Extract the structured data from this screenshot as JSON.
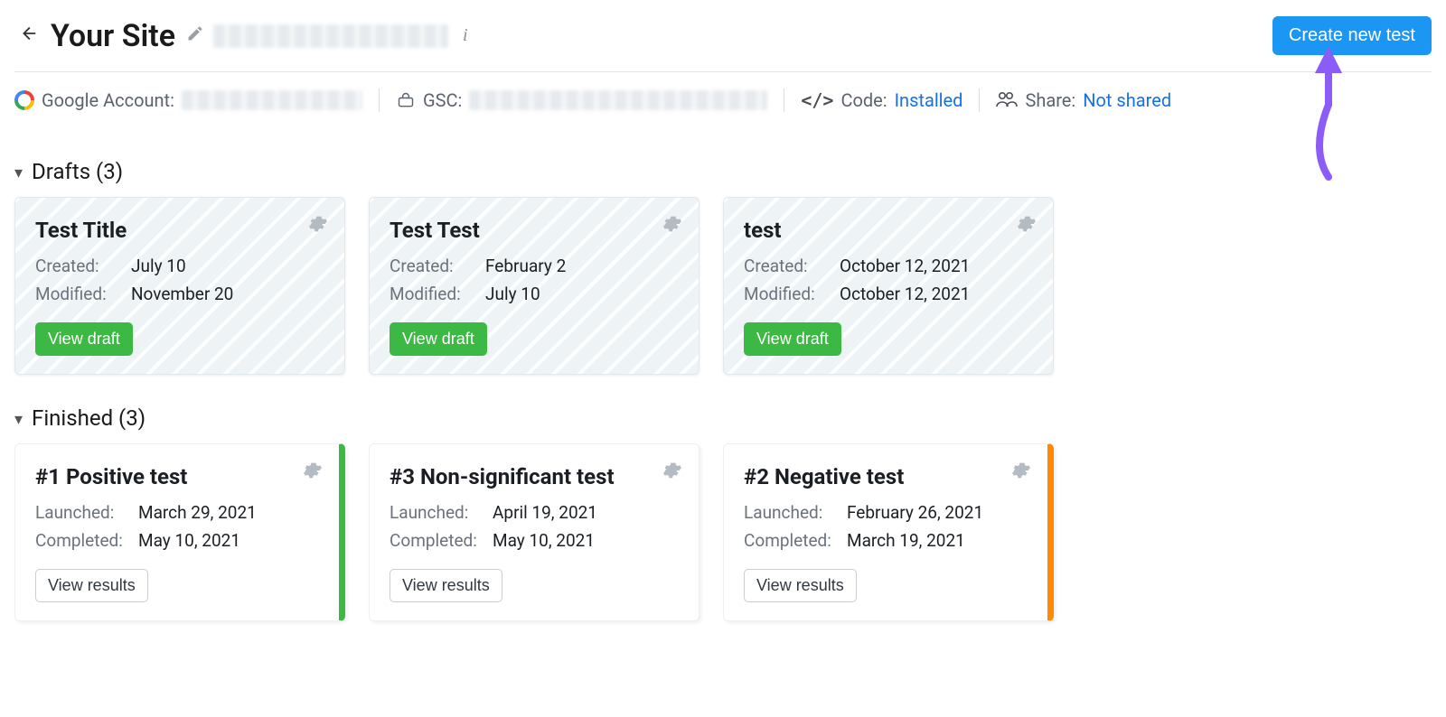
{
  "header": {
    "title": "Your Site",
    "create_button": "Create new test"
  },
  "info_bar": {
    "google_label": "Google Account:",
    "gsc_label": "GSC:",
    "code_label": "Code:",
    "code_value": "Installed",
    "share_label": "Share:",
    "share_value": "Not shared"
  },
  "sections": {
    "drafts": {
      "heading": "Drafts (3)",
      "cards": [
        {
          "title": "Test Title",
          "created_label": "Created:",
          "created": "July 10",
          "modified_label": "Modified:",
          "modified": "November 20",
          "button": "View draft"
        },
        {
          "title": "Test Test",
          "created_label": "Created:",
          "created": "February 2",
          "modified_label": "Modified:",
          "modified": "July 10",
          "button": "View draft"
        },
        {
          "title": "test",
          "created_label": "Created:",
          "created": "October 12, 2021",
          "modified_label": "Modified:",
          "modified": "October 12, 2021",
          "button": "View draft"
        }
      ]
    },
    "finished": {
      "heading": "Finished (3)",
      "cards": [
        {
          "title": "#1 Positive test",
          "accent": "green",
          "launched_label": "Launched:",
          "launched": "March 29, 2021",
          "completed_label": "Completed:",
          "completed": "May 10, 2021",
          "button": "View results"
        },
        {
          "title": "#3 Non-significant test",
          "accent": "",
          "launched_label": "Launched:",
          "launched": "April 19, 2021",
          "completed_label": "Completed:",
          "completed": "May 10, 2021",
          "button": "View results"
        },
        {
          "title": "#2 Negative test",
          "accent": "orange",
          "launched_label": "Launched:",
          "launched": "February 26, 2021",
          "completed_label": "Completed:",
          "completed": "March 19, 2021",
          "button": "View results"
        }
      ]
    }
  }
}
